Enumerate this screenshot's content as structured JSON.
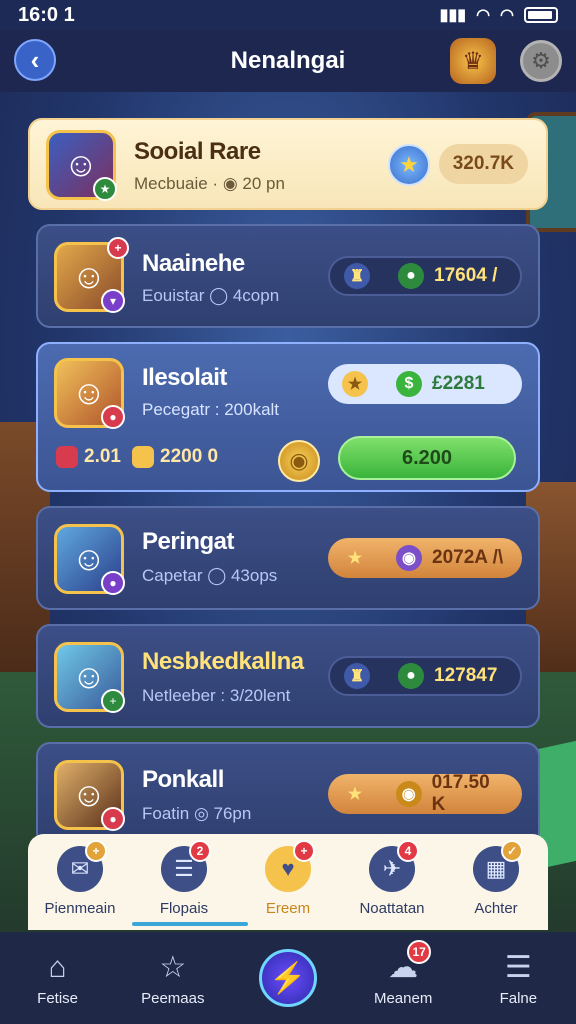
{
  "status": {
    "time": "16:0 1"
  },
  "header": {
    "title": "Nenalngai"
  },
  "cards": [
    {
      "name": "Sooial Rare",
      "meta": "Mecbuaie · ◉ 20 pn",
      "value": "320.7K"
    },
    {
      "name": "Naainehe",
      "meta": "Eouistar ◯ 4copn",
      "value": "17604 /"
    },
    {
      "name": "Ilesolait",
      "meta": "Pecegatr : 200kalt",
      "value": "£2281",
      "res_a": "2.01",
      "res_b": "2200 0",
      "action": "6.200"
    },
    {
      "name": "Peringat",
      "meta": "Capetar ◯ 43ops",
      "value": "2072A /\\"
    },
    {
      "name": "Nesbkedkallna",
      "meta": "Netleeber : 3/20lent",
      "value": "127847"
    },
    {
      "name": "Ponkall",
      "meta": "Foatin ◎ 76pn",
      "value": "017.50 K"
    }
  ],
  "tabs": [
    {
      "label": "Pienmeain",
      "badge": ""
    },
    {
      "label": "Flopais",
      "badge": "2"
    },
    {
      "label": "Ereem",
      "badge": ""
    },
    {
      "label": "Noattatan",
      "badge": "4"
    },
    {
      "label": "Achter",
      "badge": ""
    }
  ],
  "nav": [
    {
      "label": "Fetise"
    },
    {
      "label": "Peemaas"
    },
    {
      "label": ""
    },
    {
      "label": "Meanem",
      "badge": "17"
    },
    {
      "label": "Falne"
    }
  ],
  "colors": {
    "accent": "#3a63c8",
    "gold": "#f5c24b",
    "green": "#3ab43c"
  }
}
